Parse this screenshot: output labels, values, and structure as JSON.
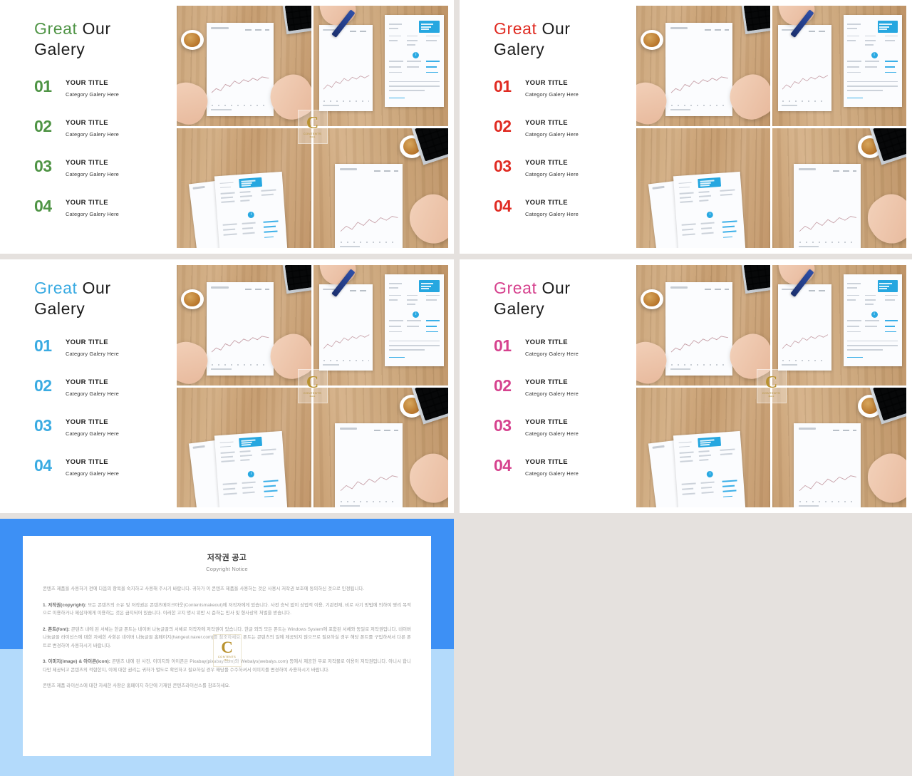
{
  "background_color": "#e5e1de",
  "slides": [
    {
      "id": "slide-green",
      "accent_color": "#4f9445",
      "headline_accent": "Great",
      "headline_rest": " Our\nGalery",
      "items": [
        {
          "num": "01",
          "title": "YOUR TITLE",
          "sub": "Category Galery Here"
        },
        {
          "num": "02",
          "title": "YOUR TITLE",
          "sub": "Category Galery Here"
        },
        {
          "num": "03",
          "title": "YOUR TITLE",
          "sub": "Category Galery Here"
        },
        {
          "num": "04",
          "title": "YOUR TITLE",
          "sub": "Category Galery Here"
        }
      ]
    },
    {
      "id": "slide-red",
      "accent_color": "#e02b22",
      "headline_accent": "Great",
      "headline_rest": " Our\nGalery",
      "items": [
        {
          "num": "01",
          "title": "YOUR TITLE",
          "sub": "Category Galery Here"
        },
        {
          "num": "02",
          "title": "YOUR TITLE",
          "sub": "Category Galery Here"
        },
        {
          "num": "03",
          "title": "YOUR TITLE",
          "sub": "Category Galery Here"
        },
        {
          "num": "04",
          "title": "YOUR TITLE",
          "sub": "Category Galery Here"
        }
      ]
    },
    {
      "id": "slide-blue",
      "accent_color": "#3aabe2",
      "headline_accent": "Great",
      "headline_rest": " Our\nGalery",
      "items": [
        {
          "num": "01",
          "title": "YOUR TITLE",
          "sub": "Category Galery Here"
        },
        {
          "num": "02",
          "title": "YOUR TITLE",
          "sub": "Category Galery Here"
        },
        {
          "num": "03",
          "title": "YOUR TITLE",
          "sub": "Category Galery Here"
        },
        {
          "num": "04",
          "title": "YOUR TITLE",
          "sub": "Category Galery Here"
        }
      ]
    },
    {
      "id": "slide-pink",
      "accent_color": "#d6428e",
      "headline_accent": "Great",
      "headline_rest": " Our\nGalery",
      "items": [
        {
          "num": "01",
          "title": "YOUR TITLE",
          "sub": "Category Galery Here"
        },
        {
          "num": "02",
          "title": "YOUR TITLE",
          "sub": "Category Galery Here"
        },
        {
          "num": "03",
          "title": "YOUR TITLE",
          "sub": "Category Galery Here"
        },
        {
          "num": "04",
          "title": "YOUR TITLE",
          "sub": "Category Galery Here"
        }
      ]
    }
  ],
  "watermark": {
    "letter": "C",
    "line1": "CONTENTS",
    "line2": "MALL"
  },
  "copyright": {
    "border_color_top": "#3d90f5",
    "border_color_bottom": "#b3dafb",
    "title": "저작권 공고",
    "subtitle": "Copyright Notice",
    "paragraphs": [
      {
        "lead": "",
        "text": "콘텐츠 제품을 사용하기 전에 다음의 항목을 숙지하고 사용해 주시기 바랍니다. 귀하가 이 콘텐츠 제품을 사용하는 것은 사용시 저작권 보호에 동의하신 것으로 인정됩니다."
      },
      {
        "lead": "1. 저작권(copyright):",
        "text": " 모든 콘텐츠의 소유 및 저작권은 콘텐츠메이크아웃(Contentsmakeout)에 저작자에게 있습니다. 사전 승낙 없이 상업적 이용, 기관전재, 비로 사기 방법에 의하여 영리 목적으로 이용하거나 제삼자에게 이용하는 것은 금지되어 있습니다. 이러한 고지 명시 위반 시 준하는 민사 및 형사상의 처벌을 받습니다."
      },
      {
        "lead": "2. 폰트(font):",
        "text": " 콘텐츠 내에 된 서체는 한글 폰트는 네이버 나눔글꼴의 서체로 저작자에 저작권이 있습니다. 한글 외의 모든 폰트는 Windows System에 포함된 서체와 동일로 저작권입니다. 네이버 나눔글꼴 라이선스에 대한 자세한 사항은 네이버 나눔글꼴 홈페이지(hangeul.naver.com)를 참조하세요. 폰트는 콘텐츠의 일에 제공되지 않으므로 필요하실 경우 해당 폰트를 구입하셔서 다른 폰트로 변경하여 사용하시기 바랍니다."
      },
      {
        "lead": "3. 이미지(image) & 아이콘(icon):",
        "text": " 콘텐츠 내에 된 사진, 이미지와 아이콘은 Pixabay(pixabay.com)와 Webalys(webalys.com) 등에서 제공한 무료 저작물로 이용이 저작권입니다. 아니시 합니다만 제공되고 콘텐츠의 적합한지, 이에 대한 권리는 귀하가 별도로 확인하고 필요하실 경우 해당를 수주하셔서 이미지를 변경하여 사용하시기 바랍니다."
      },
      {
        "lead": "",
        "text": "콘텐츠 제품 라이선스에 대한 자세한 사항은 홈페이지 하단에 기재된 콘텐츠라이선스를 참조하세요."
      }
    ]
  }
}
